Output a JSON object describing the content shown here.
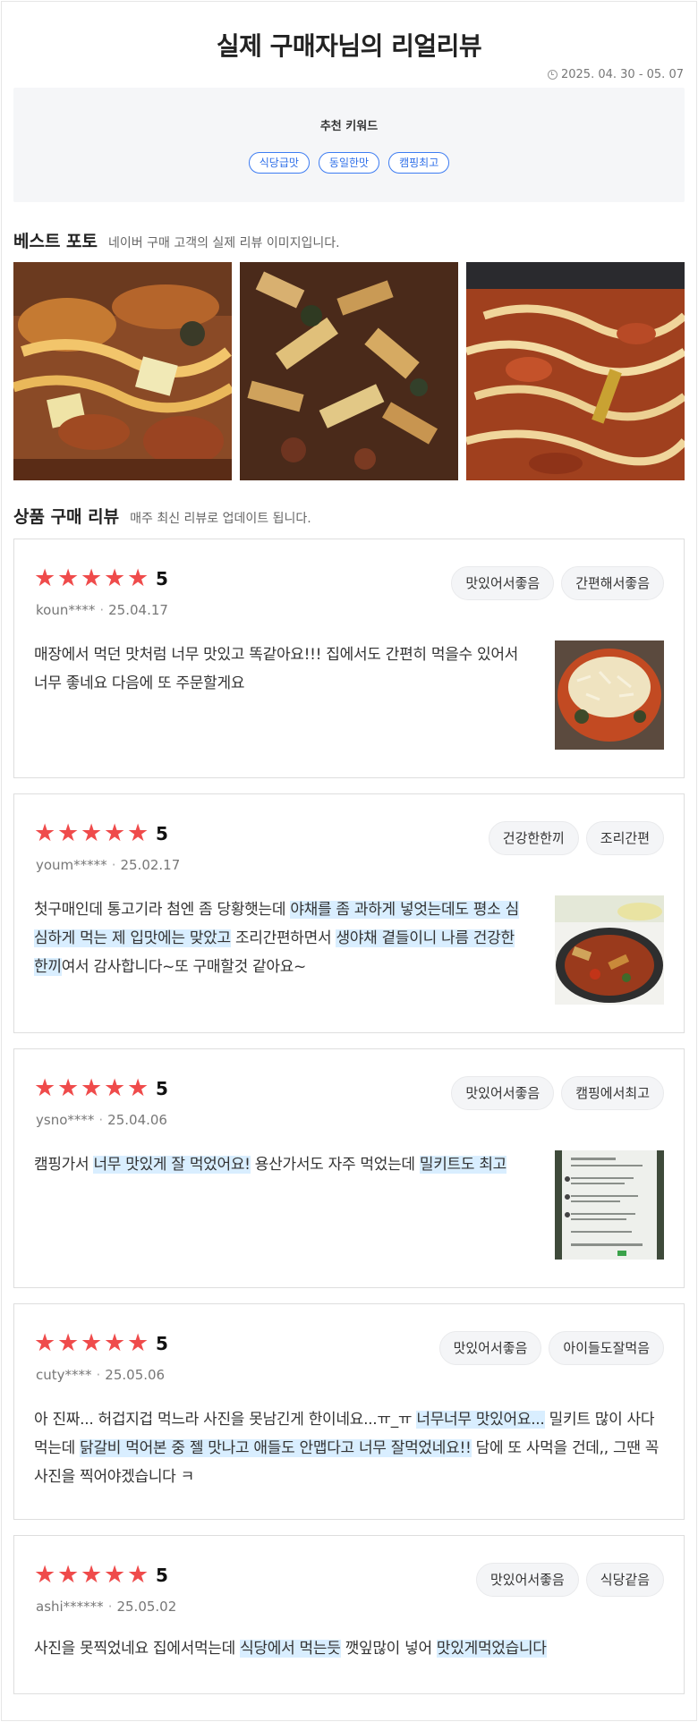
{
  "header": {
    "title": "실제 구매자님의 리얼리뷰",
    "period": "2025. 04. 30 - 05. 07",
    "clock_icon": "clock-icon"
  },
  "keywords": {
    "title": "추천 키워드",
    "items": [
      "식당급맛",
      "동일한맛",
      "캠핑최고"
    ],
    "accent": "#2f6fe8"
  },
  "best_photo": {
    "title": "베스트 포토",
    "subtitle": "네이버 구매 고객의 실제 리뷰 이미지입니다."
  },
  "reviews_section": {
    "title": "상품 구매 리뷰",
    "subtitle": "매주 최신 리뷰로 업데이트 됩니다."
  },
  "colors": {
    "star": "#ef4b4b",
    "highlight": "#d9eeff"
  },
  "reviews": [
    {
      "stars": 5,
      "rating": "5",
      "user": "koun****",
      "date": "25.04.17",
      "tags": [
        "맛있어서좋음",
        "간편해서좋음"
      ],
      "segments": [
        {
          "t": "매장에서 먹던 맛처럼 너무 맛있고 똑같아요!!! 집에서도 간편히 먹을수 있어서 너무 좋네요 다음에 또 주문할게요",
          "hl": false
        }
      ]
    },
    {
      "stars": 5,
      "rating": "5",
      "user": "youm*****",
      "date": "25.02.17",
      "tags": [
        "건강한한끼",
        "조리간편"
      ],
      "segments": [
        {
          "t": "첫구매인데 통고기라 첨엔 좀 당황햇는데 ",
          "hl": false
        },
        {
          "t": "야채를 좀 과하게 넣엇는데도 평소 심심하게 먹는 제 입맛에는 맞았고",
          "hl": true
        },
        {
          "t": " 조리간편하면서 ",
          "hl": false
        },
        {
          "t": "생야채 곁들이니 나름 건강한 한끼",
          "hl": true
        },
        {
          "t": "여서 감사합니다~또 구매할것 같아요~",
          "hl": false
        }
      ]
    },
    {
      "stars": 5,
      "rating": "5",
      "user": "ysno****",
      "date": "25.04.06",
      "tags": [
        "맛있어서좋음",
        "캠핑에서최고"
      ],
      "segments": [
        {
          "t": "캠핑가서 ",
          "hl": false
        },
        {
          "t": "너무 맛있게 잘 먹었어요!",
          "hl": true
        },
        {
          "t": " 용산가서도 자주 먹었는데 ",
          "hl": false
        },
        {
          "t": "밀키트도 최고",
          "hl": true
        }
      ]
    },
    {
      "stars": 5,
      "rating": "5",
      "user": "cuty****",
      "date": "25.05.06",
      "tags": [
        "맛있어서좋음",
        "아이들도잘먹음"
      ],
      "segments": [
        {
          "t": "아 진짜... 허겁지겁 먹느라 사진을 못남긴게 한이네요...ㅠ_ㅠ ",
          "hl": false
        },
        {
          "t": "너무너무 맛있어요...",
          "hl": true
        },
        {
          "t": " 밀키트 많이 사다먹는데 ",
          "hl": false
        },
        {
          "t": "닭갈비 먹어본 중 젤 맛나고 애들도 안맵다고 너무 잘먹었네요!!",
          "hl": true
        },
        {
          "t": " 담에 또 사먹을 건데,, 그땐 꼭 사진을 찍어야겠습니다 ㅋ",
          "hl": false
        }
      ]
    },
    {
      "stars": 5,
      "rating": "5",
      "user": "ashi******",
      "date": "25.05.02",
      "tags": [
        "맛있어서좋음",
        "식당같음"
      ],
      "segments": [
        {
          "t": "사진을 못찍었네요 집에서먹는데 ",
          "hl": false
        },
        {
          "t": "식당에서 먹는듯",
          "hl": true
        },
        {
          "t": " 깻잎많이 넣어 ",
          "hl": false
        },
        {
          "t": "맛있게먹었습니다",
          "hl": true
        }
      ]
    }
  ]
}
